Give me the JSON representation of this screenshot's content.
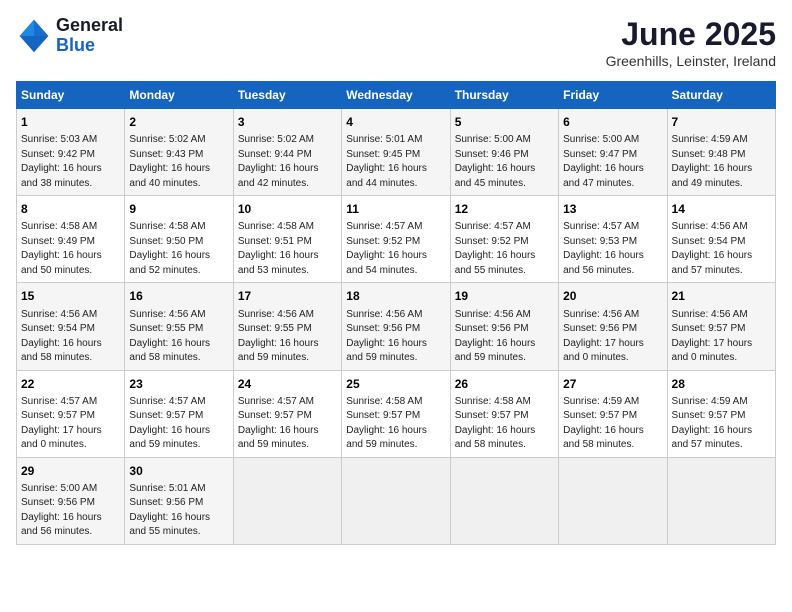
{
  "header": {
    "logo_general": "General",
    "logo_blue": "Blue",
    "month_title": "June 2025",
    "location": "Greenhills, Leinster, Ireland"
  },
  "days_of_week": [
    "Sunday",
    "Monday",
    "Tuesday",
    "Wednesday",
    "Thursday",
    "Friday",
    "Saturday"
  ],
  "weeks": [
    [
      {
        "day": "1",
        "sunrise": "5:03 AM",
        "sunset": "9:42 PM",
        "daylight": "16 hours and 38 minutes."
      },
      {
        "day": "2",
        "sunrise": "5:02 AM",
        "sunset": "9:43 PM",
        "daylight": "16 hours and 40 minutes."
      },
      {
        "day": "3",
        "sunrise": "5:02 AM",
        "sunset": "9:44 PM",
        "daylight": "16 hours and 42 minutes."
      },
      {
        "day": "4",
        "sunrise": "5:01 AM",
        "sunset": "9:45 PM",
        "daylight": "16 hours and 44 minutes."
      },
      {
        "day": "5",
        "sunrise": "5:00 AM",
        "sunset": "9:46 PM",
        "daylight": "16 hours and 45 minutes."
      },
      {
        "day": "6",
        "sunrise": "5:00 AM",
        "sunset": "9:47 PM",
        "daylight": "16 hours and 47 minutes."
      },
      {
        "day": "7",
        "sunrise": "4:59 AM",
        "sunset": "9:48 PM",
        "daylight": "16 hours and 49 minutes."
      }
    ],
    [
      {
        "day": "8",
        "sunrise": "4:58 AM",
        "sunset": "9:49 PM",
        "daylight": "16 hours and 50 minutes."
      },
      {
        "day": "9",
        "sunrise": "4:58 AM",
        "sunset": "9:50 PM",
        "daylight": "16 hours and 52 minutes."
      },
      {
        "day": "10",
        "sunrise": "4:58 AM",
        "sunset": "9:51 PM",
        "daylight": "16 hours and 53 minutes."
      },
      {
        "day": "11",
        "sunrise": "4:57 AM",
        "sunset": "9:52 PM",
        "daylight": "16 hours and 54 minutes."
      },
      {
        "day": "12",
        "sunrise": "4:57 AM",
        "sunset": "9:52 PM",
        "daylight": "16 hours and 55 minutes."
      },
      {
        "day": "13",
        "sunrise": "4:57 AM",
        "sunset": "9:53 PM",
        "daylight": "16 hours and 56 minutes."
      },
      {
        "day": "14",
        "sunrise": "4:56 AM",
        "sunset": "9:54 PM",
        "daylight": "16 hours and 57 minutes."
      }
    ],
    [
      {
        "day": "15",
        "sunrise": "4:56 AM",
        "sunset": "9:54 PM",
        "daylight": "16 hours and 58 minutes."
      },
      {
        "day": "16",
        "sunrise": "4:56 AM",
        "sunset": "9:55 PM",
        "daylight": "16 hours and 58 minutes."
      },
      {
        "day": "17",
        "sunrise": "4:56 AM",
        "sunset": "9:55 PM",
        "daylight": "16 hours and 59 minutes."
      },
      {
        "day": "18",
        "sunrise": "4:56 AM",
        "sunset": "9:56 PM",
        "daylight": "16 hours and 59 minutes."
      },
      {
        "day": "19",
        "sunrise": "4:56 AM",
        "sunset": "9:56 PM",
        "daylight": "16 hours and 59 minutes."
      },
      {
        "day": "20",
        "sunrise": "4:56 AM",
        "sunset": "9:56 PM",
        "daylight": "17 hours and 0 minutes."
      },
      {
        "day": "21",
        "sunrise": "4:56 AM",
        "sunset": "9:57 PM",
        "daylight": "17 hours and 0 minutes."
      }
    ],
    [
      {
        "day": "22",
        "sunrise": "4:57 AM",
        "sunset": "9:57 PM",
        "daylight": "17 hours and 0 minutes."
      },
      {
        "day": "23",
        "sunrise": "4:57 AM",
        "sunset": "9:57 PM",
        "daylight": "16 hours and 59 minutes."
      },
      {
        "day": "24",
        "sunrise": "4:57 AM",
        "sunset": "9:57 PM",
        "daylight": "16 hours and 59 minutes."
      },
      {
        "day": "25",
        "sunrise": "4:58 AM",
        "sunset": "9:57 PM",
        "daylight": "16 hours and 59 minutes."
      },
      {
        "day": "26",
        "sunrise": "4:58 AM",
        "sunset": "9:57 PM",
        "daylight": "16 hours and 58 minutes."
      },
      {
        "day": "27",
        "sunrise": "4:59 AM",
        "sunset": "9:57 PM",
        "daylight": "16 hours and 58 minutes."
      },
      {
        "day": "28",
        "sunrise": "4:59 AM",
        "sunset": "9:57 PM",
        "daylight": "16 hours and 57 minutes."
      }
    ],
    [
      {
        "day": "29",
        "sunrise": "5:00 AM",
        "sunset": "9:56 PM",
        "daylight": "16 hours and 56 minutes."
      },
      {
        "day": "30",
        "sunrise": "5:01 AM",
        "sunset": "9:56 PM",
        "daylight": "16 hours and 55 minutes."
      },
      null,
      null,
      null,
      null,
      null
    ]
  ]
}
